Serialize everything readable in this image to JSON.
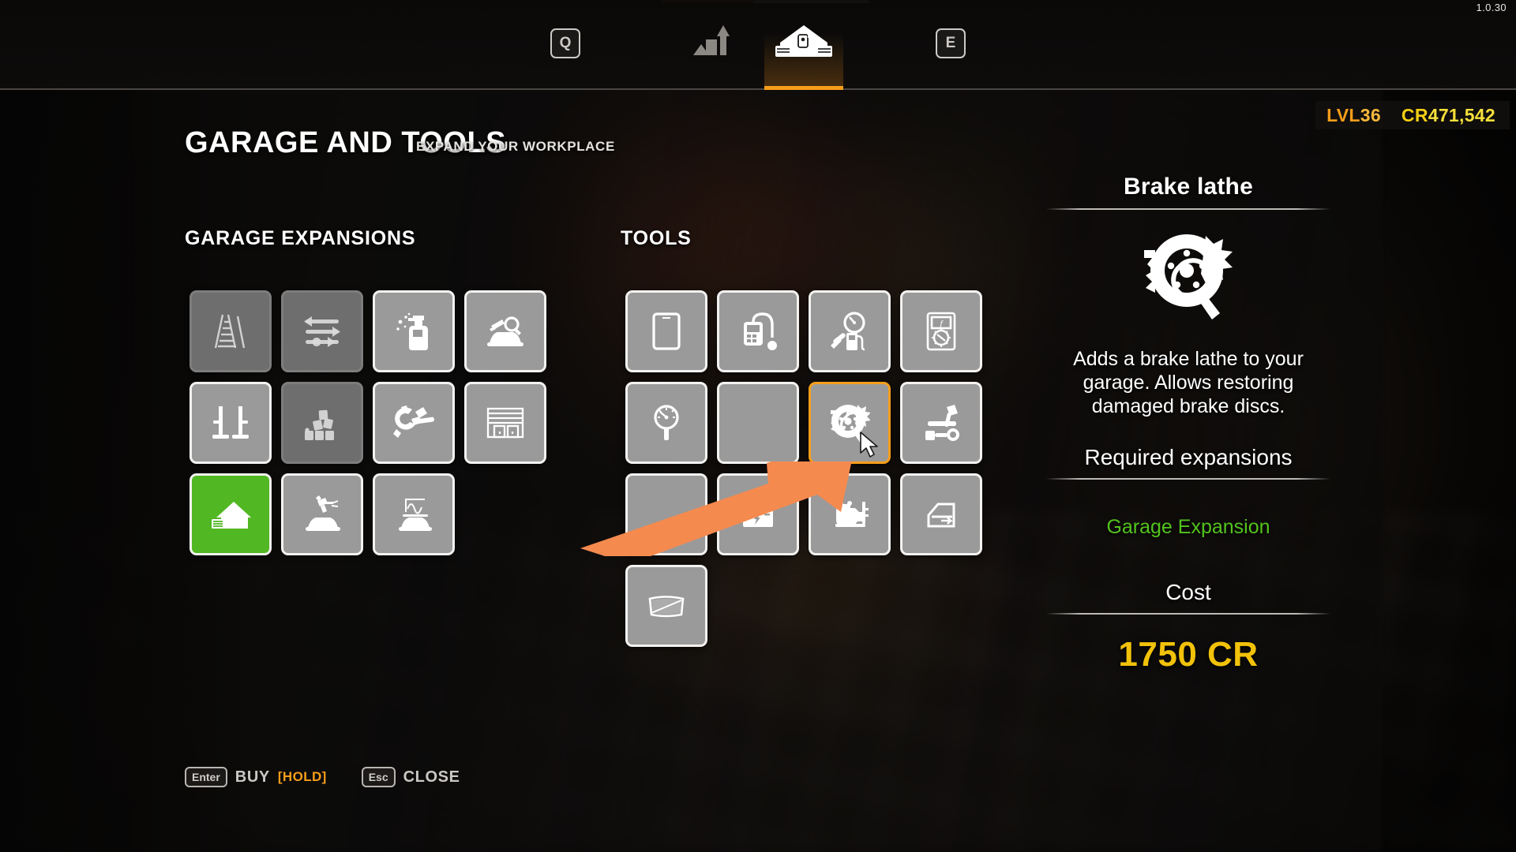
{
  "app": {
    "version": "1.0.30"
  },
  "topnav": {
    "prev_key": "Q",
    "next_key": "E",
    "tabs": [
      {
        "name": "upgrades-tab",
        "icon": "bar-growth-icon",
        "active": false
      },
      {
        "name": "garage-and-tools-tab",
        "icon": "garage-house-icon",
        "active": true
      }
    ]
  },
  "header": {
    "title": "GARAGE AND TOOLS",
    "subtitle": "EXPAND YOUR WORKPLACE"
  },
  "hud": {
    "level_label": "LVL",
    "level_value": "36",
    "credits_label": "CR",
    "credits_value": "471,542",
    "level_color": "#f79e1b",
    "credits_color": "#f4cf13"
  },
  "sections": {
    "expansions_heading": "GARAGE EXPANSIONS",
    "tools_heading": "TOOLS"
  },
  "expansions": [
    {
      "name": "ladder-expansion",
      "icon": "ladder-icon",
      "state": "dim"
    },
    {
      "name": "sliders-expansion",
      "icon": "sliders-icon",
      "state": "dim"
    },
    {
      "name": "car-wash-expansion",
      "icon": "spray-bottle-icon",
      "state": "available"
    },
    {
      "name": "body-inspection-expansion",
      "icon": "car-inspect-icon",
      "state": "available"
    },
    {
      "name": "car-lift-expansion",
      "icon": "car-lift-icon",
      "state": "available"
    },
    {
      "name": "barn-expansion",
      "icon": "barn-bricks-icon",
      "state": "dim"
    },
    {
      "name": "repair-expansion",
      "icon": "hammer-gear-icon",
      "state": "available"
    },
    {
      "name": "garage-door-expansion",
      "icon": "garage-door-icon",
      "state": "available"
    },
    {
      "name": "garage-expansion",
      "icon": "garage-house-icon",
      "state": "owned"
    },
    {
      "name": "paint-shop-expansion",
      "icon": "spray-gun-car-icon",
      "state": "available"
    },
    {
      "name": "dyno-expansion",
      "icon": "dyno-car-icon",
      "state": "available"
    }
  ],
  "tools": [
    {
      "name": "tablet-tool",
      "icon": "tablet-icon",
      "state": "available"
    },
    {
      "name": "diagnostic-scanner-tool",
      "icon": "scanner-icon",
      "state": "available"
    },
    {
      "name": "fuel-tester-tool",
      "icon": "fuel-pump-gauge-icon",
      "state": "available"
    },
    {
      "name": "multimeter-tool",
      "icon": "multimeter-icon",
      "state": "available"
    },
    {
      "name": "pressure-gauge-tool",
      "icon": "pressure-gauge-icon",
      "state": "available"
    },
    {
      "name": "hidden-tool-behind-arrow",
      "icon": "obscured-icon",
      "state": "available"
    },
    {
      "name": "brake-lathe-tool",
      "icon": "brake-disc-lathe-icon",
      "state": "selected"
    },
    {
      "name": "workbench-tool",
      "icon": "workbench-hammer-icon",
      "state": "available"
    },
    {
      "name": "hidden-tool-behind-arrow-2",
      "icon": "obscured-icon",
      "state": "available"
    },
    {
      "name": "battery-charger-tool",
      "icon": "battery-icon",
      "state": "available"
    },
    {
      "name": "engine-crane-tool",
      "icon": "engine-stand-icon",
      "state": "available"
    },
    {
      "name": "door-tool",
      "icon": "car-door-icon",
      "state": "available"
    },
    {
      "name": "windshield-tool",
      "icon": "windshield-icon",
      "state": "available"
    }
  ],
  "detail": {
    "title": "Brake lathe",
    "icon": "brake-disc-lathe-icon",
    "description": "Adds a brake lathe to your garage. Allows restoring damaged brake discs.",
    "required_heading": "Required expansions",
    "required_items": [
      "Garage Expansion"
    ],
    "required_color": "#53c31d",
    "cost_heading": "Cost",
    "cost_value": "1750",
    "cost_unit": "CR",
    "cost_color": "#f2c20a"
  },
  "footer": [
    {
      "name": "buy-action",
      "key": "Enter",
      "label": "BUY",
      "hold": "[HOLD]"
    },
    {
      "name": "close-action",
      "key": "Esc",
      "label": "CLOSE",
      "hold": ""
    }
  ]
}
